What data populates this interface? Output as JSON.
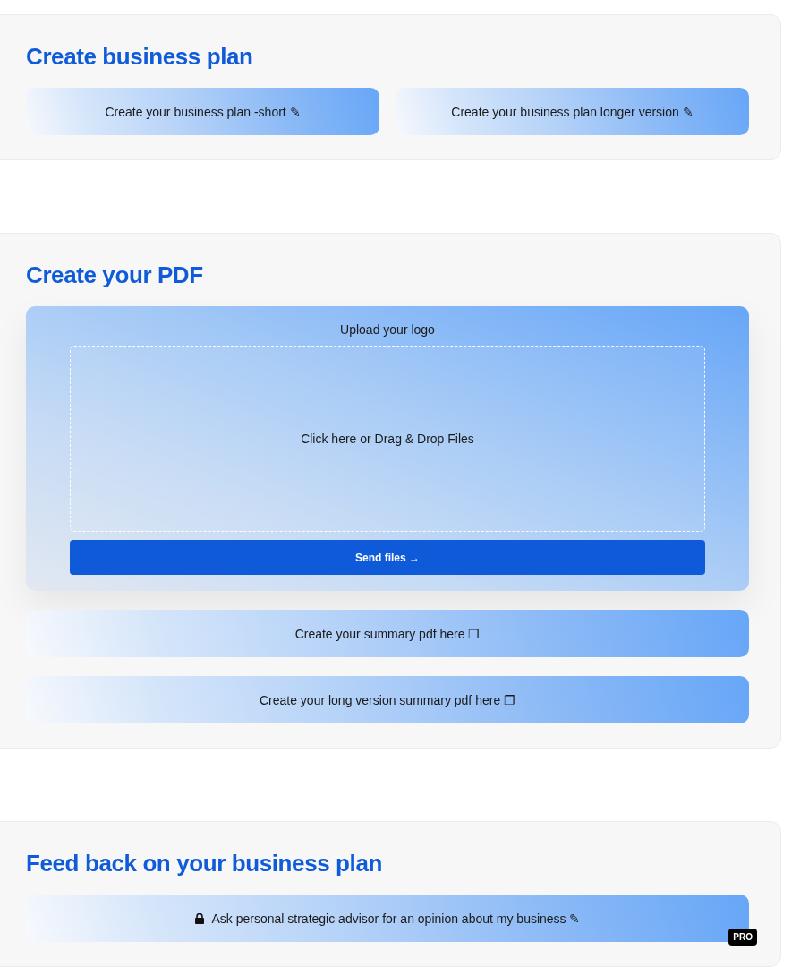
{
  "sections": [
    {
      "title": "Create business plan",
      "items": [
        {
          "kind": "button_row",
          "buttons": [
            {
              "label": "Create your business plan -short ✎",
              "locked": false
            },
            {
              "label": "Create your business plan longer version ✎",
              "locked": false
            }
          ]
        }
      ]
    },
    {
      "title": "Create your PDF",
      "items": [
        {
          "kind": "upload",
          "label": "Upload your logo",
          "dropzone": {
            "placeholder": "Click here or Drag & Drop Files"
          },
          "button": "Send files →"
        },
        {
          "kind": "button",
          "label": "Create your summary pdf here ❐",
          "locked": false
        },
        {
          "kind": "button",
          "label": "Create your long version summary pdf here ❐",
          "locked": false
        }
      ]
    },
    {
      "title": "Feed back on your business plan",
      "items": [
        {
          "kind": "button",
          "label": "Ask personal strategic advisor for an opinion about my business ✎",
          "locked": true,
          "badge": "PRO"
        }
      ]
    }
  ]
}
